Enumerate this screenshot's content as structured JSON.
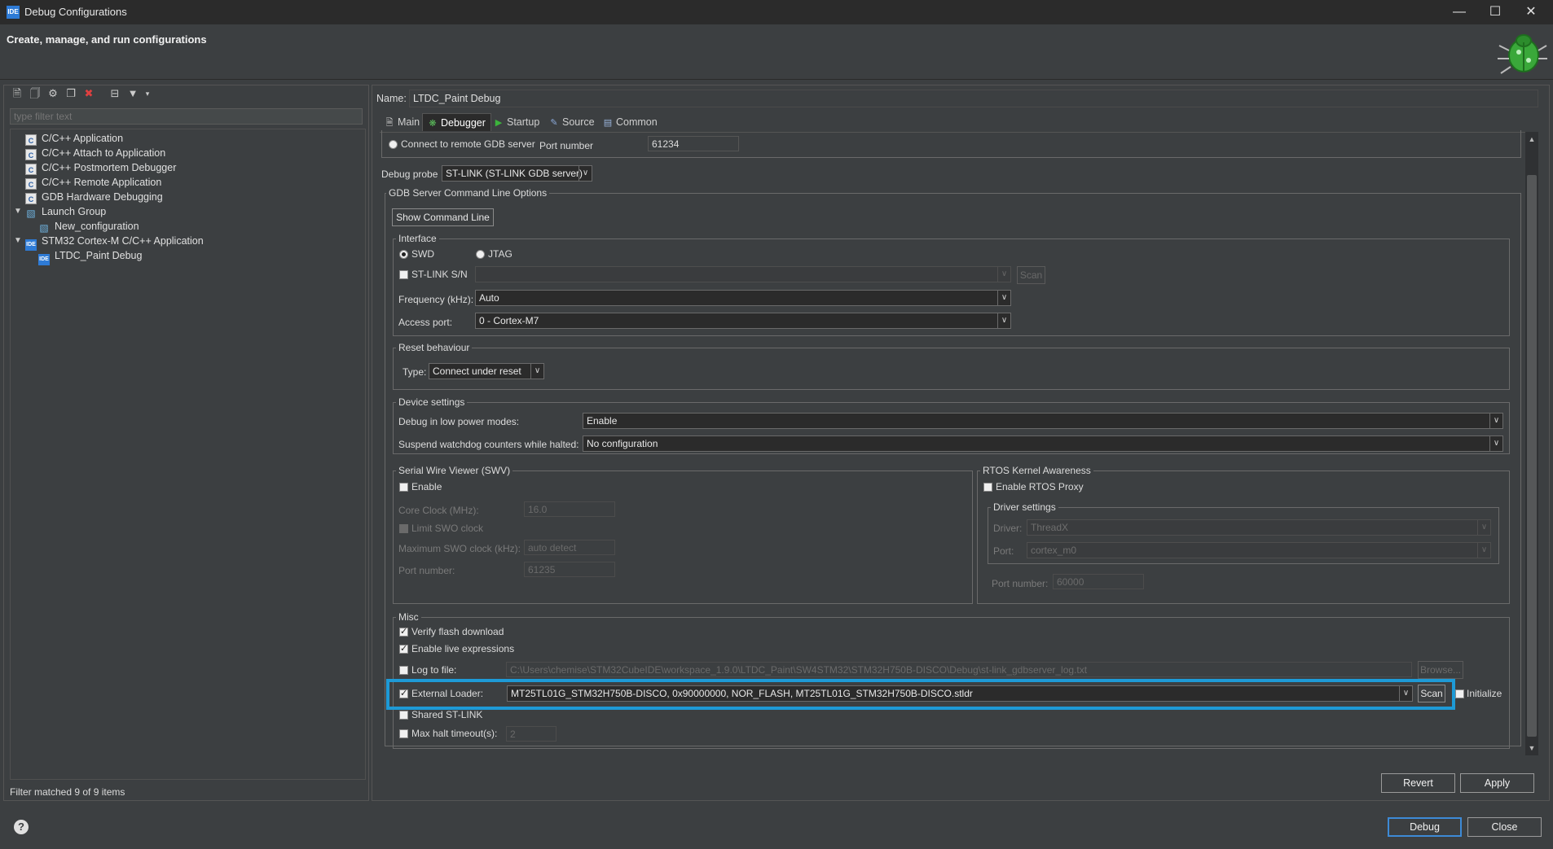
{
  "window": {
    "title": "Debug Configurations",
    "app_icon": "IDE",
    "minimize": "—",
    "maximize": "☐",
    "close": "✕"
  },
  "header": {
    "heading": "Create, manage, and run configurations"
  },
  "left": {
    "filter_placeholder": "type filter text",
    "tree": [
      {
        "label": "C/C++ Application",
        "icon": "C"
      },
      {
        "label": "C/C++ Attach to Application",
        "icon": "C"
      },
      {
        "label": "C/C++ Postmortem Debugger",
        "icon": "C"
      },
      {
        "label": "C/C++ Remote Application",
        "icon": "C"
      },
      {
        "label": "GDB Hardware Debugging",
        "icon": "C"
      },
      {
        "label": "Launch Group",
        "icon": "launch-group-icon"
      },
      {
        "label": "New_configuration",
        "icon": "launch-group-icon"
      },
      {
        "label": "STM32 Cortex-M C/C++ Application",
        "icon": "IDE"
      },
      {
        "label": "LTDC_Paint Debug",
        "icon": "IDE"
      }
    ],
    "status": "Filter matched 9 of 9 items"
  },
  "right": {
    "name_label": "Name:",
    "name_value": "LTDC_Paint Debug",
    "tabs": [
      {
        "label": "Main",
        "icon": "main-tab-icon"
      },
      {
        "label": "Debugger",
        "icon": "debugger-bug-icon"
      },
      {
        "label": "Startup",
        "icon": "play-icon"
      },
      {
        "label": "Source",
        "icon": "source-icon"
      },
      {
        "label": "Common",
        "icon": "common-icon"
      }
    ],
    "remote_gdb": {
      "label": "Connect to remote GDB server",
      "port_label": "Port number",
      "port_value": "61234"
    },
    "debug_probe": {
      "label": "Debug probe",
      "value": "ST-LINK (ST-LINK GDB server)"
    },
    "gdb_cmd": {
      "title": "GDB Server Command Line Options",
      "show_button": "Show Command Line"
    },
    "interface": {
      "title": "Interface",
      "swd": "SWD",
      "jtag": "JTAG",
      "stlink_sn": "ST-LINK S/N",
      "scan": "Scan",
      "freq_label": "Frequency (kHz):",
      "freq_value": "Auto",
      "access_label": "Access port:",
      "access_value": "0 - Cortex-M7"
    },
    "reset": {
      "title": "Reset behaviour",
      "type_label": "Type:",
      "type_value": "Connect under reset"
    },
    "device": {
      "title": "Device settings",
      "lowpower_label": "Debug in low power modes:",
      "lowpower_value": "Enable",
      "watchdog_label": "Suspend watchdog counters while halted:",
      "watchdog_value": "No configuration"
    },
    "swv": {
      "title": "Serial Wire Viewer (SWV)",
      "enable": "Enable",
      "core_clock_label": "Core Clock (MHz):",
      "core_clock_value": "16.0",
      "limit_swo": "Limit SWO clock",
      "max_swo_label": "Maximum SWO clock (kHz):",
      "max_swo_value": "auto detect",
      "port_label": "Port number:",
      "port_value": "61235"
    },
    "rtos": {
      "title": "RTOS Kernel Awareness",
      "enable_proxy": "Enable RTOS Proxy",
      "driver_settings": "Driver settings",
      "driver_label": "Driver:",
      "driver_value": "ThreadX",
      "port_label": "Port:",
      "port_value": "cortex_m0",
      "port_number_label": "Port number:",
      "port_number_value": "60000"
    },
    "misc": {
      "title": "Misc",
      "verify_flash": "Verify flash download",
      "live_expr": "Enable live expressions",
      "log_to_file": "Log to file:",
      "log_path": "C:\\Users\\chemise\\STM32CubeIDE\\workspace_1.9.0\\LTDC_Paint\\SW4STM32\\STM32H750B-DISCO\\Debug\\st-link_gdbserver_log.txt",
      "browse": "Browse...",
      "ext_loader_label": "External Loader:",
      "ext_loader_value": "MT25TL01G_STM32H750B-DISCO, 0x90000000, NOR_FLASH, MT25TL01G_STM32H750B-DISCO.stldr",
      "scan": "Scan",
      "initialize": "Initialize",
      "shared_stlink": "Shared ST-LINK",
      "max_halt_label": "Max halt timeout(s):",
      "max_halt_value": "2"
    },
    "revert": "Revert",
    "apply": "Apply"
  },
  "footer": {
    "help": "?",
    "debug": "Debug",
    "close": "Close"
  },
  "colors": {
    "highlight": "#1e9ad6",
    "background": "#3c3f41",
    "titlebar": "#2b2b2b"
  }
}
